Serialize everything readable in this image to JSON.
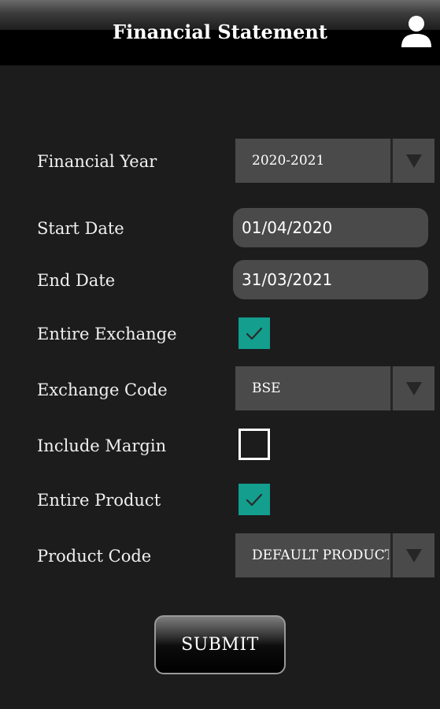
{
  "header": {
    "title": "Financial Statement",
    "user_icon": "user-icon"
  },
  "form": {
    "financial_year": {
      "label": "Financial Year",
      "value": "2020-2021",
      "icon": "dropdown-arrow-icon"
    },
    "start_date": {
      "label": "Start Date",
      "value": "01/04/2020"
    },
    "end_date": {
      "label": "End Date",
      "value": "31/03/2021"
    },
    "entire_exchange": {
      "label": "Entire Exchange",
      "checked": true,
      "icon": "check-icon"
    },
    "exchange_code": {
      "label": "Exchange Code",
      "value": "BSE",
      "icon": "dropdown-arrow-icon"
    },
    "include_margin": {
      "label": "Include Margin",
      "checked": false
    },
    "entire_product": {
      "label": "Entire Product",
      "checked": true,
      "icon": "check-icon"
    },
    "product_code": {
      "label": "Product Code",
      "value": "DEFAULT PRODUCT",
      "icon": "dropdown-arrow-icon"
    }
  },
  "submit_label": "SUBMIT",
  "colors": {
    "background": "#1c1c1c",
    "header": "#000000",
    "field": "#4a4a4a",
    "checkbox_checked": "#139e8e"
  }
}
